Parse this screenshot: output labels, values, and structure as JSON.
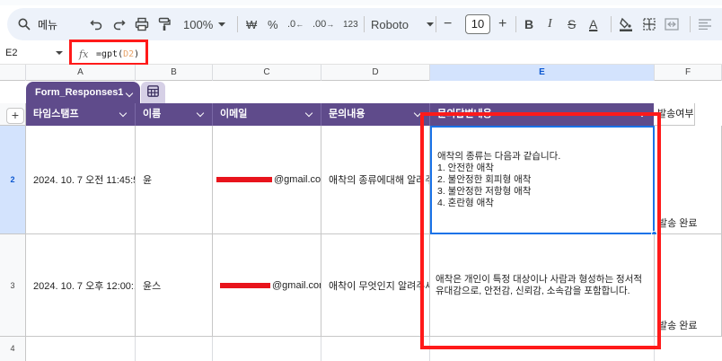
{
  "toolbar": {
    "menu_label": "메뉴",
    "zoom": "100%",
    "currency": "₩",
    "percent": "%",
    "decimal_less": ".0",
    "decimal_more": ".00",
    "number_format": "123",
    "font": "Roboto",
    "font_size": "10",
    "font_size_minus": "−",
    "font_size_plus": "+",
    "bold": "B",
    "italic": "I",
    "strikethrough": "S",
    "text_color": "A"
  },
  "formula_bar": {
    "name_box": "E2",
    "fx_label": "fx",
    "formula_prefix": "=gpt(",
    "formula_ref": "D2",
    "formula_suffix": ")"
  },
  "columns": [
    "A",
    "B",
    "C",
    "D",
    "E",
    "F"
  ],
  "table": {
    "tab_name": "Form_Responses1",
    "headers": [
      "타임스탬프",
      "이름",
      "이메일",
      "문의내용",
      "문의답변내용",
      "발송여부"
    ]
  },
  "rows": [
    {
      "num": "2",
      "timestamp": "2024. 10. 7 오전 11:45:5",
      "name": "윤",
      "email_suffix": "@gmail.com",
      "inquiry": "애착의 종류에대해 알려주",
      "answer_lines": [
        "애착의 종류는 다음과 같습니다.",
        "1. 안전한 애착",
        "2. 불안정한 회피형 애착",
        "3. 불안정한 저항형 애착",
        "4. 혼란형 애착"
      ],
      "status": "발송 완료"
    },
    {
      "num": "3",
      "timestamp": "2024. 10. 7 오후 12:00:1",
      "name": "윤스",
      "email_suffix": "@gmail.com",
      "inquiry": "애착이 무엇인지 알려주세",
      "answer": "애착은 개인이 특정 대상이나 사람과 형성하는 정서적 유대감으로, 안전감, 신뢰감, 소속감을 포함합니다.",
      "status": "발송 완료"
    },
    {
      "num": "4"
    }
  ],
  "colors": {
    "table_header": "#5f4b8b",
    "highlight": "#ff1a1a",
    "selection": "#1a73e8"
  }
}
